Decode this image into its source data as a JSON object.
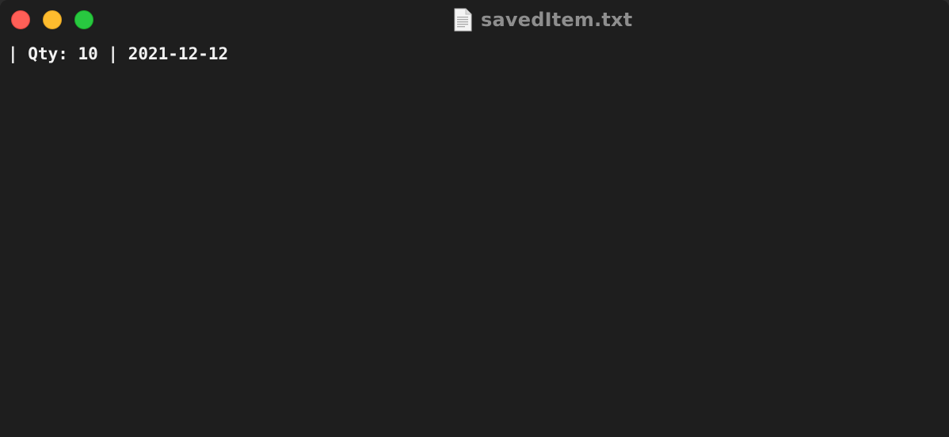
{
  "window": {
    "title": "savedItem.txt",
    "title_icon": "text-document-icon",
    "colors": {
      "background": "#1e1e1e",
      "title_text": "#8e8e8e",
      "content_text": "#f2f2f2",
      "close": "#ff5f57",
      "minimize": "#febc2e",
      "zoom": "#28c840"
    }
  },
  "traffic_lights": {
    "close": "close-window-button",
    "minimize": "minimize-window-button",
    "zoom": "zoom-window-button"
  },
  "document": {
    "lines": [
      "| Qty: 10 | 2021-12-12"
    ]
  }
}
